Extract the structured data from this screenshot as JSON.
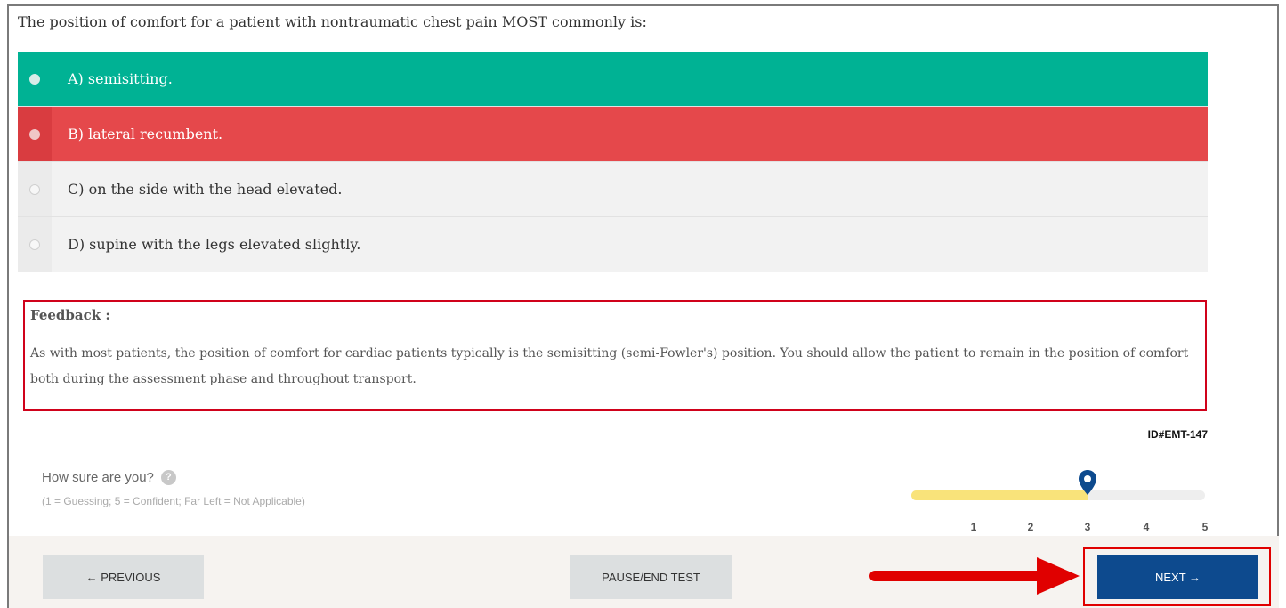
{
  "question": {
    "text": "The position of comfort for a patient with nontraumatic chest pain MOST commonly is:"
  },
  "options": [
    {
      "label": "A) semisitting.",
      "state": "correct"
    },
    {
      "label": "B) lateral recumbent.",
      "state": "incorrect"
    },
    {
      "label": "C) on the side with the head elevated.",
      "state": "none"
    },
    {
      "label": "D) supine with the legs elevated slightly.",
      "state": "none"
    }
  ],
  "feedback": {
    "title": "Feedback :",
    "text": "As with most patients, the position of comfort for cardiac patients typically is the semisitting (semi-Fowler's) position. You should allow the patient to remain in the position of comfort both during the assessment phase and throughout transport."
  },
  "question_id": "ID#EMT-147",
  "confidence": {
    "label": "How sure are you?",
    "help_glyph": "?",
    "hint": "(1 = Guessing; 5 = Confident; Far Left = Not Applicable)",
    "ticks": [
      "1",
      "2",
      "3",
      "4",
      "5"
    ],
    "selected": 3,
    "icons": {
      "help": "question-mark-icon",
      "marker": "map-pin-icon"
    }
  },
  "navigation": {
    "previous_label": "← PREVIOUS",
    "pause_label": "PAUSE/END TEST",
    "next_label": "NEXT →"
  },
  "colors": {
    "correct": "#00b294",
    "incorrect": "#e5484b",
    "primary": "#0d4a8e",
    "slider_fill": "#f9e37a",
    "highlight": "#e00000"
  }
}
